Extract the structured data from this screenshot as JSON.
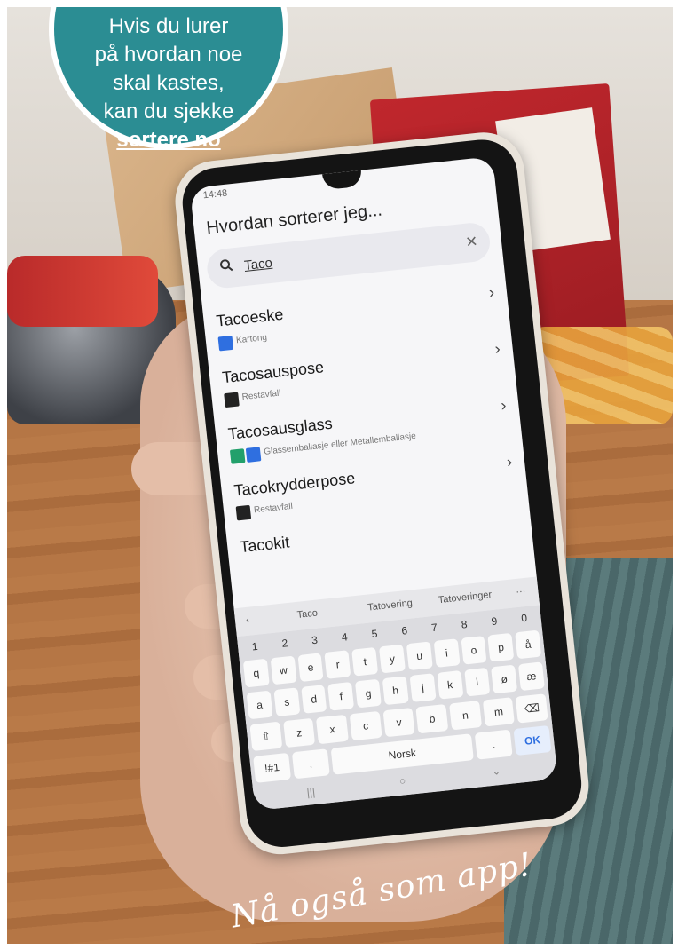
{
  "badge": {
    "lines": [
      "Hvis du lurer",
      "på hvordan noe",
      "skal kastes,",
      "kan du sjekke"
    ],
    "link": "sortere.no"
  },
  "phone": {
    "status_time": "14:48",
    "app_title": "Hvordan sorterer jeg...",
    "search": {
      "value": "Taco",
      "icon": "search-icon",
      "clear_icon": "close-icon"
    },
    "results": [
      {
        "name": "Tacoeske",
        "category": "Kartong",
        "icon_color": "#2f6fe0",
        "icons": [
          "kartong-icon"
        ]
      },
      {
        "name": "Tacosauspose",
        "category": "Restavfall",
        "icon_color": "#222222",
        "icons": [
          "restavfall-icon"
        ]
      },
      {
        "name": "Tacosausglass",
        "category": "Glassemballasje eller Metallemballasje",
        "icon_color": "#22a06b",
        "icons": [
          "glass-icon",
          "metall-icon"
        ]
      },
      {
        "name": "Tacokrydderpose",
        "category": "Restavfall",
        "icon_color": "#222222",
        "icons": [
          "restavfall-icon"
        ]
      },
      {
        "name": "Tacokit",
        "category": "",
        "icon_color": "#222222",
        "icons": []
      }
    ],
    "suggestions": [
      "Taco",
      "Tatovering",
      "Tatoveringer"
    ],
    "keyboard": {
      "numbers": [
        "1",
        "2",
        "3",
        "4",
        "5",
        "6",
        "7",
        "8",
        "9",
        "0"
      ],
      "row1": [
        "q",
        "w",
        "e",
        "r",
        "t",
        "y",
        "u",
        "i",
        "o",
        "p",
        "å"
      ],
      "row2": [
        "a",
        "s",
        "d",
        "f",
        "g",
        "h",
        "j",
        "k",
        "l",
        "ø",
        "æ"
      ],
      "row3": [
        "⇧",
        "z",
        "x",
        "c",
        "v",
        "b",
        "n",
        "m",
        "⌫"
      ],
      "row4": [
        "!#1",
        ",",
        "Norsk",
        ".",
        "OK"
      ]
    }
  },
  "tagline": "Nå også som app!"
}
